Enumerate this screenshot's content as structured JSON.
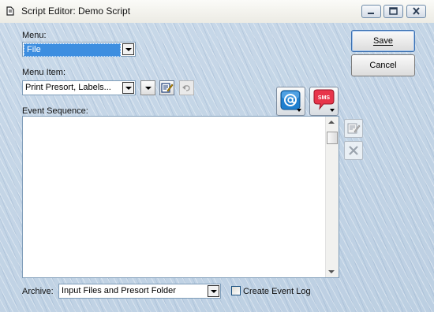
{
  "window": {
    "title": "Script Editor: Demo Script",
    "controls": {
      "minimize_icon": "minimize-icon",
      "maximize_icon": "maximize-icon",
      "close_icon": "close-icon"
    }
  },
  "menu": {
    "label": "Menu:",
    "selected": "File"
  },
  "menu_item": {
    "label": "Menu Item:",
    "selected": "Print Presort, Labels..."
  },
  "buttons": {
    "save": "Save",
    "cancel": "Cancel"
  },
  "event_sequence": {
    "label": "Event Sequence:",
    "items": []
  },
  "archive": {
    "label": "Archive:",
    "selected": "Input Files and Presort Folder"
  },
  "create_event_log": {
    "label": "Create Event Log",
    "checked": false
  },
  "icons": {
    "email": "email-icon",
    "sms": "sms-icon",
    "edit": "edit-icon",
    "undo": "undo-icon",
    "delete": "delete-icon",
    "sms_text": "SMS"
  },
  "colors": {
    "selection": "#3d8ee0",
    "background": "#c4d5e6"
  }
}
